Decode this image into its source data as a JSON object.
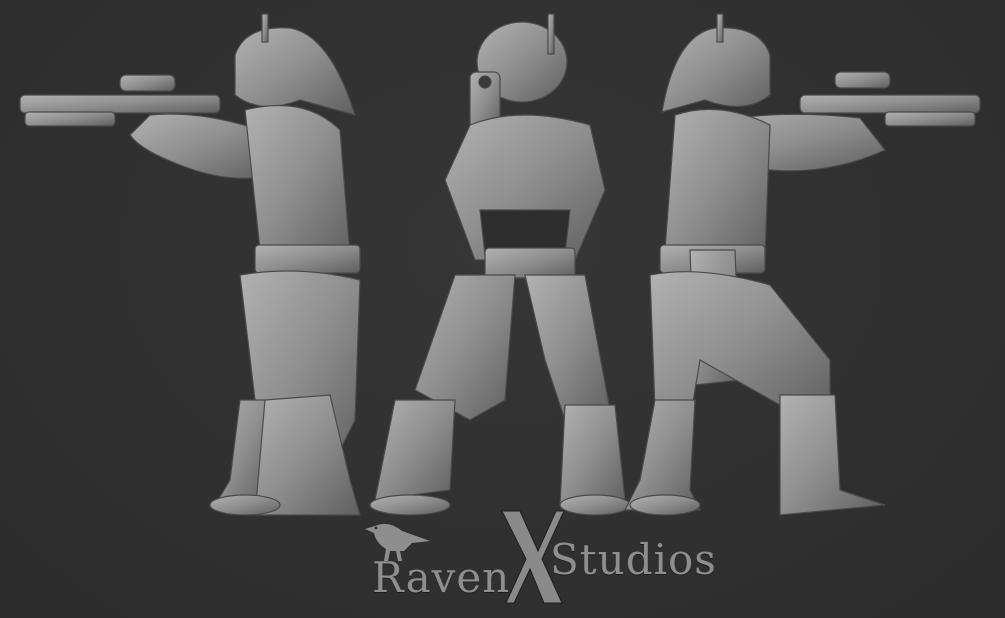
{
  "colors": {
    "background": "#313131",
    "figure": "#8f8f8f",
    "figure_dark": "#6a6a6a",
    "figure_light": "#b0b0b0",
    "logo_text": "#8e8e8e"
  },
  "logo": {
    "word_left": "Raven",
    "word_right": "Studios",
    "mark": "X",
    "icons": [
      "raven-bird-icon"
    ]
  },
  "figures": [
    {
      "view": "left-side"
    },
    {
      "view": "front"
    },
    {
      "view": "right-side"
    }
  ]
}
